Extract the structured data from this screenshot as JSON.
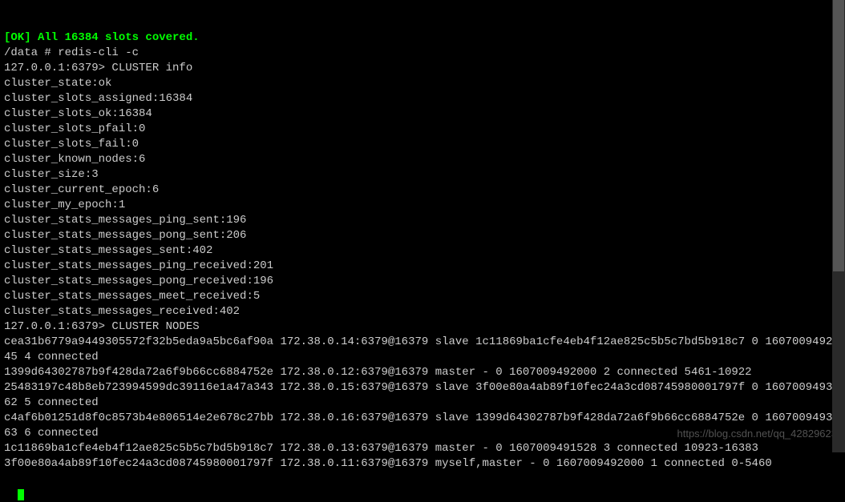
{
  "terminal": {
    "lines": [
      {
        "text": "[OK] All 16384 slots covered.",
        "class": "green"
      },
      {
        "text": "/data # redis-cli -c"
      },
      {
        "text": "127.0.0.1:6379> CLUSTER info"
      },
      {
        "text": "cluster_state:ok"
      },
      {
        "text": "cluster_slots_assigned:16384"
      },
      {
        "text": "cluster_slots_ok:16384"
      },
      {
        "text": "cluster_slots_pfail:0"
      },
      {
        "text": "cluster_slots_fail:0"
      },
      {
        "text": "cluster_known_nodes:6"
      },
      {
        "text": "cluster_size:3"
      },
      {
        "text": "cluster_current_epoch:6"
      },
      {
        "text": "cluster_my_epoch:1"
      },
      {
        "text": "cluster_stats_messages_ping_sent:196"
      },
      {
        "text": "cluster_stats_messages_pong_sent:206"
      },
      {
        "text": "cluster_stats_messages_sent:402"
      },
      {
        "text": "cluster_stats_messages_ping_received:201"
      },
      {
        "text": "cluster_stats_messages_pong_received:196"
      },
      {
        "text": "cluster_stats_messages_meet_received:5"
      },
      {
        "text": "cluster_stats_messages_received:402"
      },
      {
        "text": "127.0.0.1:6379> CLUSTER NODES"
      },
      {
        "text": "cea31b6779a9449305572f32b5eda9a5bc6af90a 172.38.0.14:6379@16379 slave 1c11869ba1cfe4eb4f12ae825c5b5c7bd5b918c7 0 1607009492445 4 connected"
      },
      {
        "text": "1399d64302787b9f428da72a6f9b66cc6884752e 172.38.0.12:6379@16379 master - 0 1607009492000 2 connected 5461-10922"
      },
      {
        "text": "25483197c48b8eb723994599dc39116e1a47a343 172.38.0.15:6379@16379 slave 3f00e80a4ab89f10fec24a3cd08745980001797f 0 1607009493462 5 connected"
      },
      {
        "text": "c4af6b01251d8f0c8573b4e806514e2e678c27bb 172.38.0.16:6379@16379 slave 1399d64302787b9f428da72a6f9b66cc6884752e 0 1607009493563 6 connected"
      },
      {
        "text": "1c11869ba1cfe4eb4f12ae825c5b5c7bd5b918c7 172.38.0.13:6379@16379 master - 0 1607009491528 3 connected 10923-16383"
      },
      {
        "text": "3f00e80a4ab89f10fec24a3cd08745980001797f 172.38.0.11:6379@16379 myself,master - 0 1607009492000 1 connected 0-5460"
      }
    ],
    "prompt_partial": ""
  },
  "watermark": "https://blog.csdn.net/qq_42829623"
}
